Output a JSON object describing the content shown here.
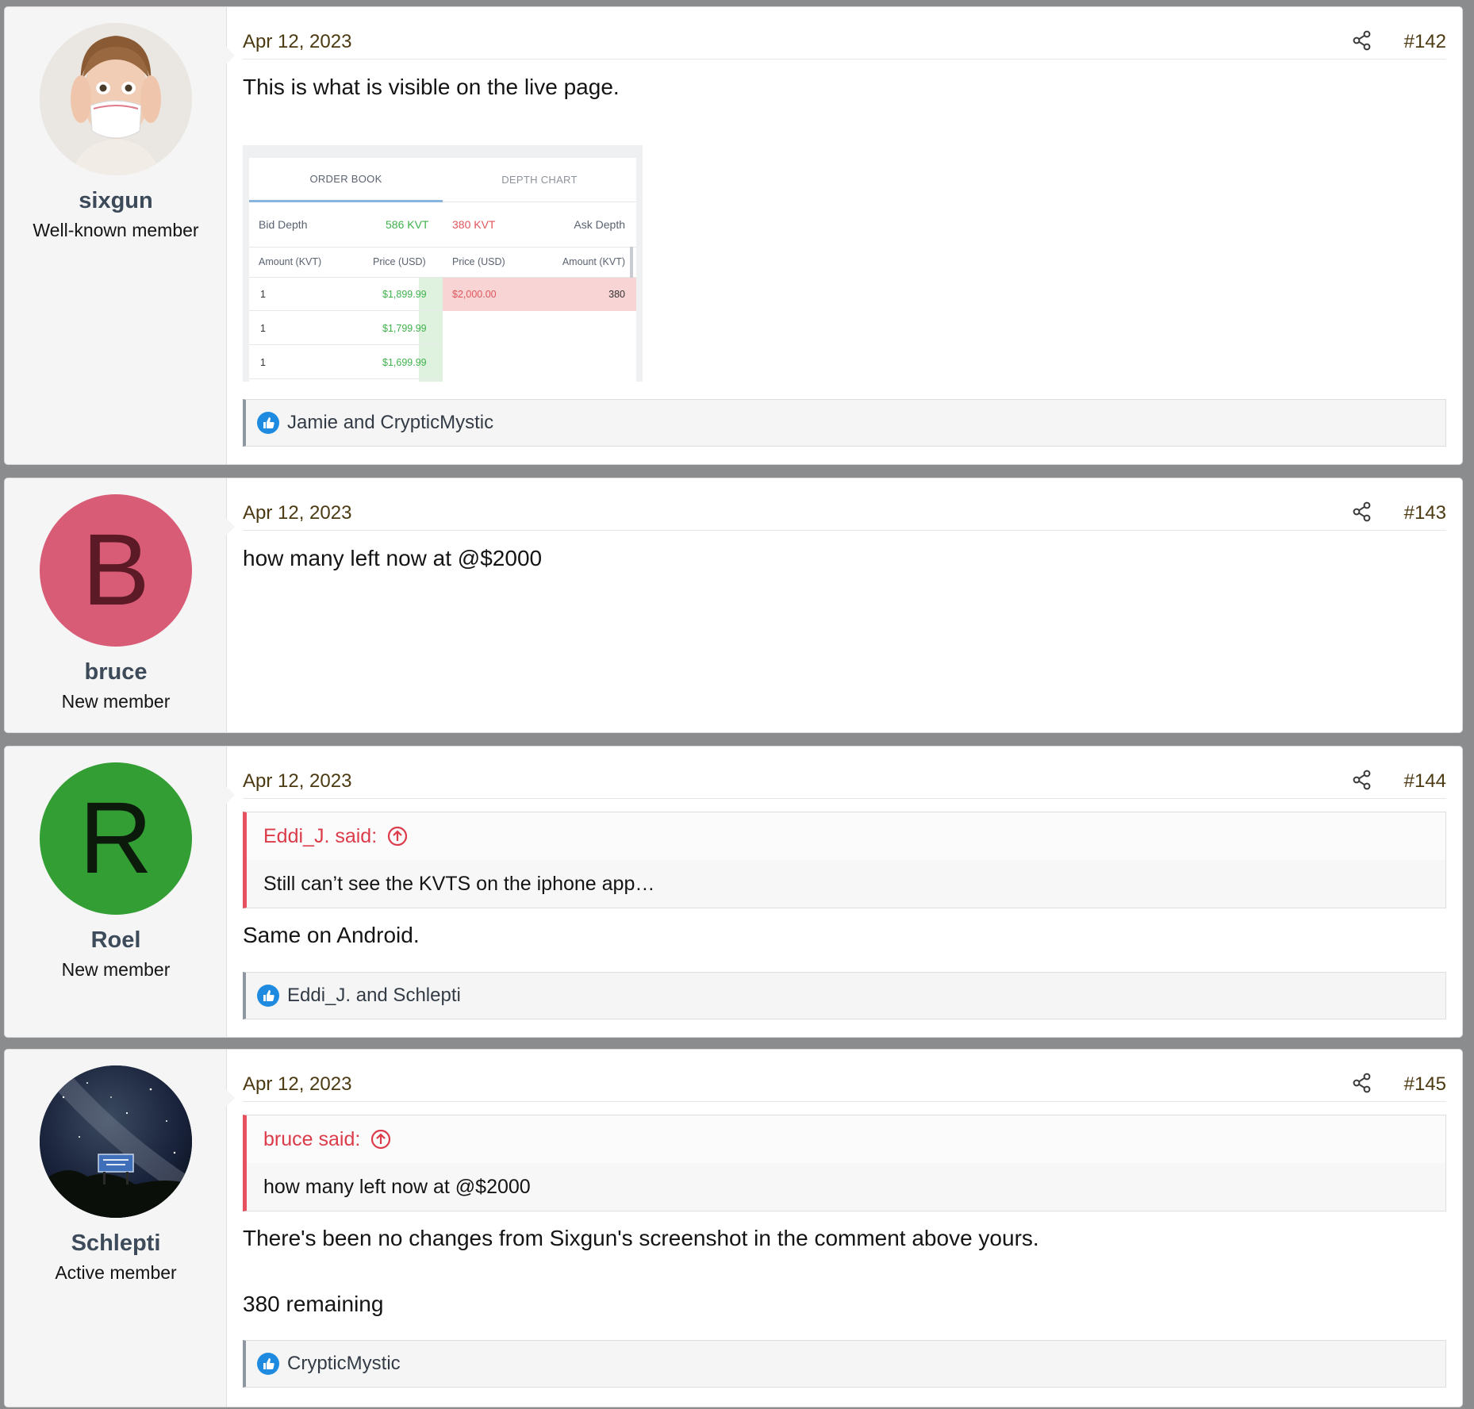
{
  "posts": [
    {
      "user": {
        "name": "sixgun",
        "title": "Well-known member",
        "avatar_icon": "masked-woman-avatar"
      },
      "date": "Apr 12, 2023",
      "number": "#142",
      "body": [
        "This is what is visible on the live page."
      ],
      "attachment": {
        "tabs": [
          "ORDER BOOK",
          "DEPTH CHART"
        ],
        "bid_depth_label": "Bid Depth",
        "bid_depth_value": "586 KVT",
        "ask_depth_value": "380 KVT",
        "ask_depth_label": "Ask Depth",
        "columns": [
          "Amount (KVT)",
          "Price (USD)",
          "Price (USD)",
          "Amount (KVT)"
        ],
        "bids": [
          {
            "amount": "1",
            "price": "$1,899.99"
          },
          {
            "amount": "1",
            "price": "$1,799.99"
          },
          {
            "amount": "1",
            "price": "$1,699.99"
          }
        ],
        "asks": [
          {
            "price": "$2,000.00",
            "amount": "380"
          }
        ]
      },
      "reactions": "Jamie and CrypticMystic"
    },
    {
      "user": {
        "name": "bruce",
        "title": "New member",
        "initial": "B",
        "avatar_color": "#d95c76",
        "initial_color": "#5c1a26"
      },
      "date": "Apr 12, 2023",
      "number": "#143",
      "body": [
        "how many left now at @$2000"
      ]
    },
    {
      "user": {
        "name": "Roel",
        "title": "New member",
        "initial": "R",
        "avatar_color": "#339e33",
        "initial_color": "#0c1a0c"
      },
      "date": "Apr 12, 2023",
      "number": "#144",
      "quote": {
        "author": "Eddi_J. said:",
        "text": "Still can’t see the KVTS on the iphone app…"
      },
      "body": [
        "Same on Android."
      ],
      "reactions": "Eddi_J. and Schlepti"
    },
    {
      "user": {
        "name": "Schlepti",
        "title": "Active member",
        "avatar_icon": "night-sky-sign-avatar"
      },
      "date": "Apr 12, 2023",
      "number": "#145",
      "quote": {
        "author": "bruce said:",
        "text": "how many left now at @$2000"
      },
      "body": [
        "There's been no changes from Sixgun's screenshot in the comment above yours.",
        "380 remaining"
      ],
      "reactions": "CrypticMystic"
    }
  ],
  "colors": {
    "page_bg": "#8a8c8e",
    "quote_accent": "#e7505f",
    "like_blue": "#1f8be0",
    "bid_green": "#3fb24c",
    "ask_red": "#e0565c"
  }
}
